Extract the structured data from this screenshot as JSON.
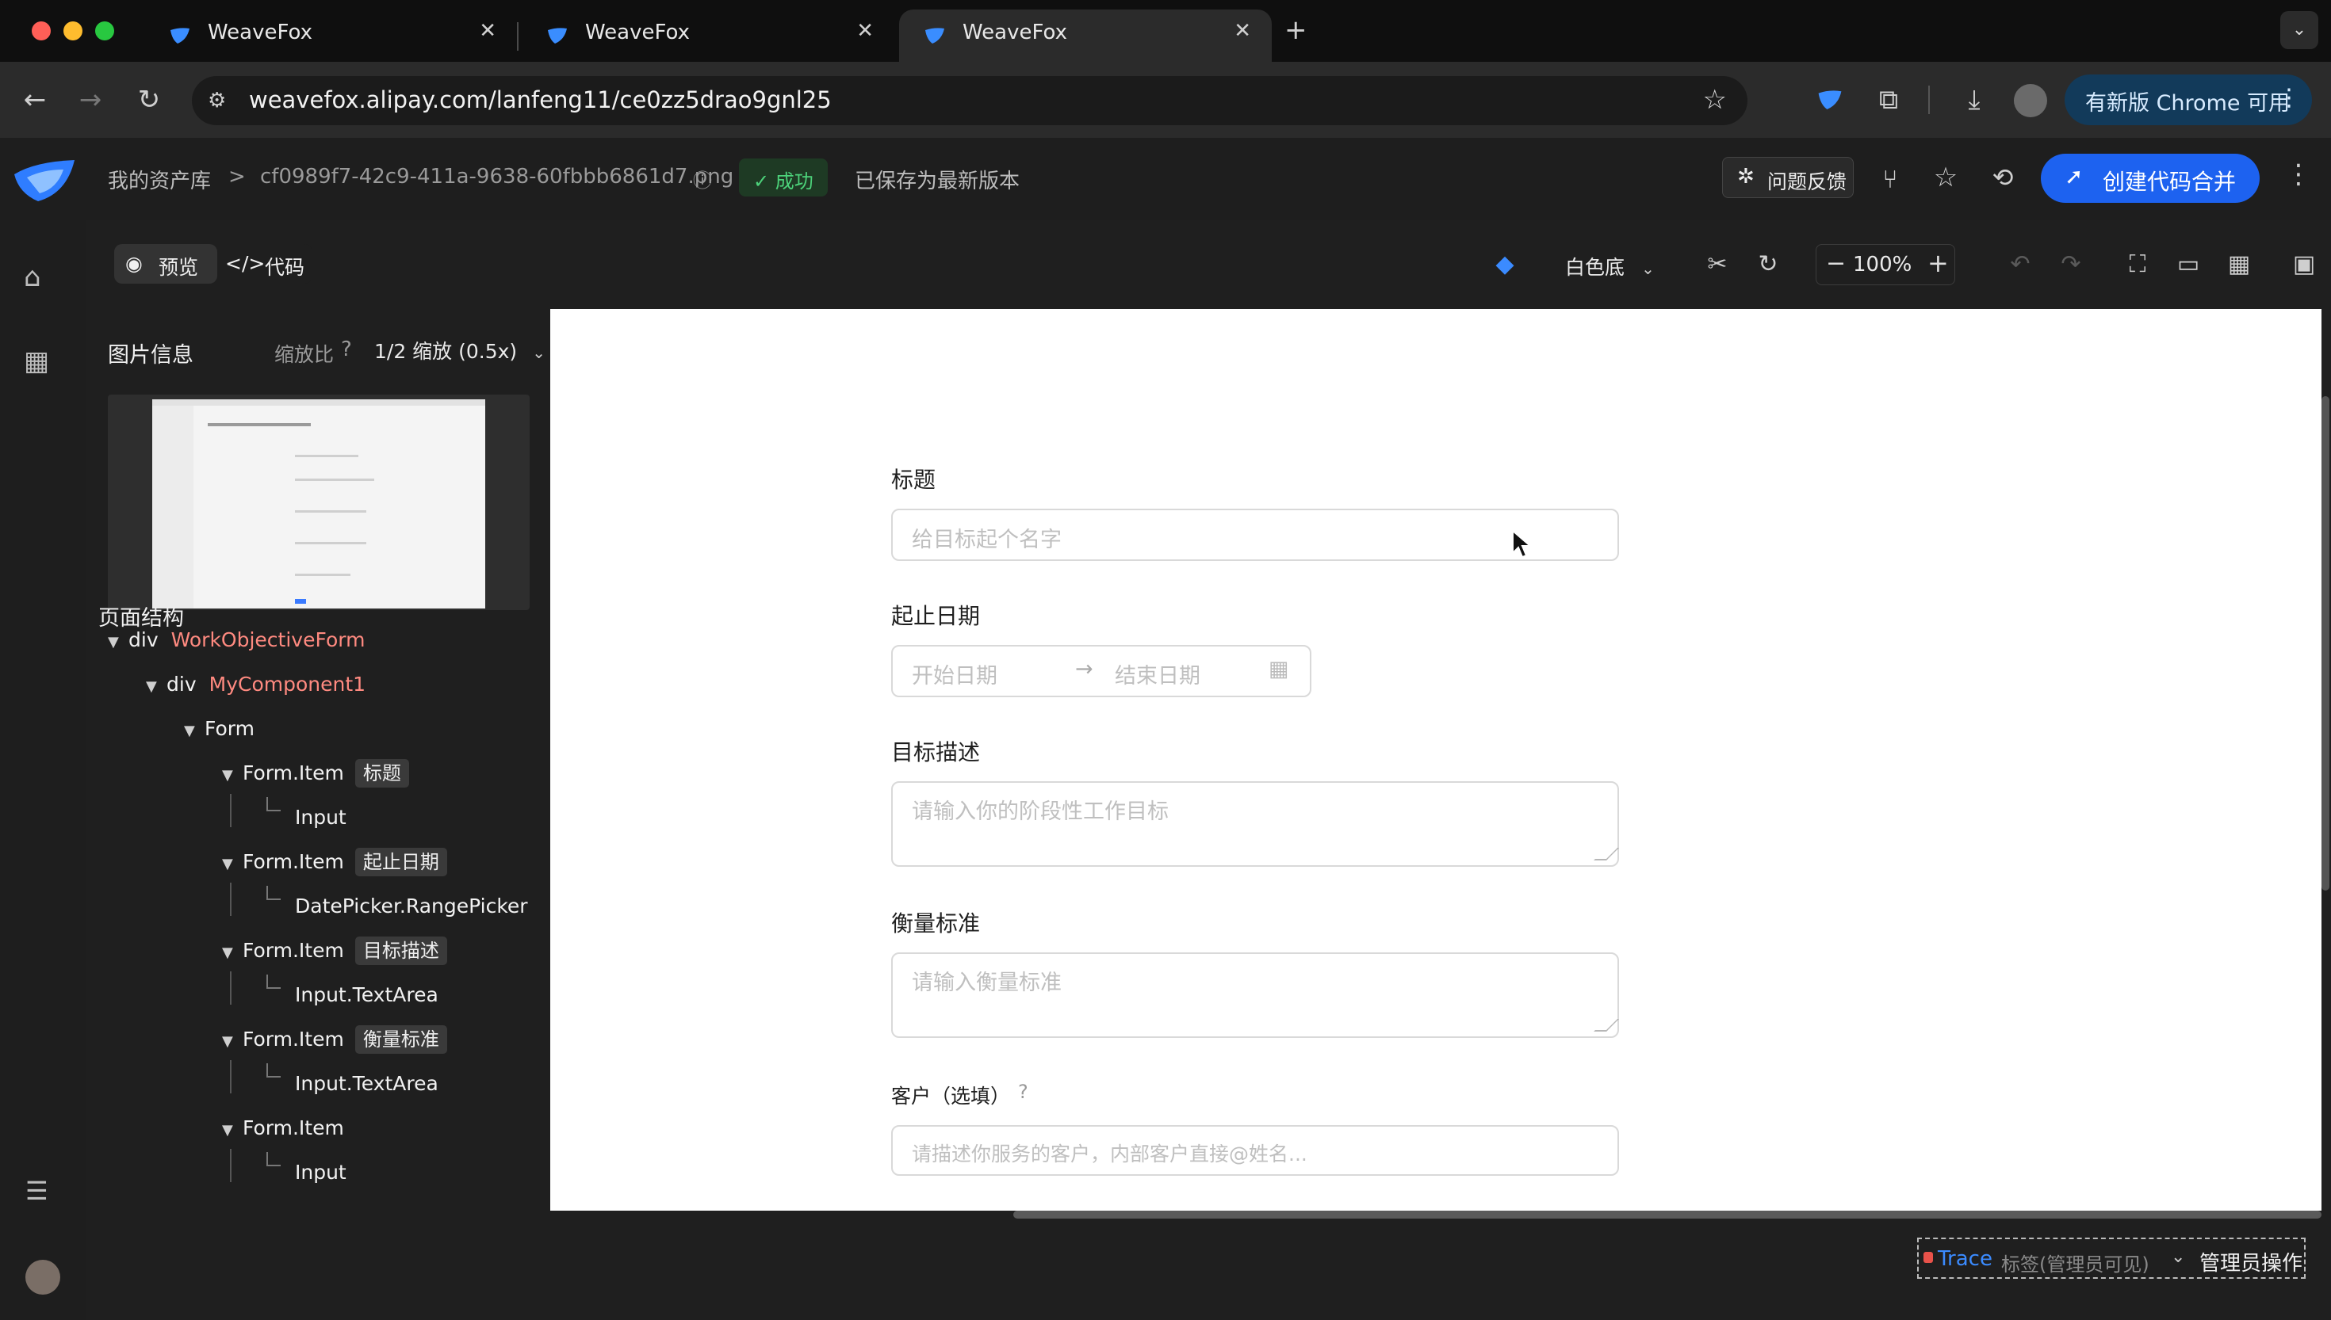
{
  "browser": {
    "tabs": [
      {
        "title": "WeaveFox",
        "active": false
      },
      {
        "title": "WeaveFox",
        "active": false
      },
      {
        "title": "WeaveFox",
        "active": true
      }
    ],
    "url": "weavefox.alipay.com/lanfeng11/ce0zz5drao9gnl25",
    "update_chip": "有新版 Chrome 可用"
  },
  "header": {
    "breadcrumb_root": "我的资产库",
    "breadcrumb_sep": ">",
    "file_name": "cf0989f7-42c9-411a-9638-60fbbb6861d7.png",
    "status": "成功",
    "saved_text": "已保存为最新版本",
    "feedback": "问题反馈",
    "merge": "创建代码合并"
  },
  "tabs": {
    "preview": "预览",
    "code": "代码"
  },
  "canvas_toolbar": {
    "background_select": "白色底",
    "zoom": "100%"
  },
  "panel": {
    "image_info_title": "图片信息",
    "scale_label": "缩放比",
    "scale_value": "1/2 缩放 (0.5x)",
    "structure_title": "页面结构",
    "tree": [
      {
        "tag": "div",
        "comp": "WorkObjectiveForm"
      },
      {
        "tag": "div",
        "comp": "MyComponent1"
      },
      {
        "tag": "Form"
      },
      {
        "tag": "Form.Item",
        "label": "标题"
      },
      {
        "tag": "Input"
      },
      {
        "tag": "Form.Item",
        "label": "起止日期"
      },
      {
        "tag": "DatePicker.RangePicker"
      },
      {
        "tag": "Form.Item",
        "label": "目标描述"
      },
      {
        "tag": "Input.TextArea"
      },
      {
        "tag": "Form.Item",
        "label": "衡量标准"
      },
      {
        "tag": "Input.TextArea"
      },
      {
        "tag": "Form.Item"
      },
      {
        "tag": "Input"
      }
    ]
  },
  "form": {
    "title_label": "标题",
    "title_placeholder": "给目标起个名字",
    "date_label": "起止日期",
    "date_start": "开始日期",
    "date_arrow": "→",
    "date_end": "结束日期",
    "desc_label": "目标描述",
    "desc_placeholder": "请输入你的阶段性工作目标",
    "measure_label": "衡量标准",
    "measure_placeholder": "请输入衡量标准",
    "customer_label": "客户（选填）",
    "customer_placeholder": "请描述你服务的客户，内部客户直接@姓名..."
  },
  "trace": {
    "trace": "Trace",
    "tag": "标签(管理员可见)",
    "admin": "管理员操作"
  },
  "colors": {
    "accent": "#1d62f0",
    "success": "#4cd27a",
    "component_name": "#ff8a80"
  }
}
